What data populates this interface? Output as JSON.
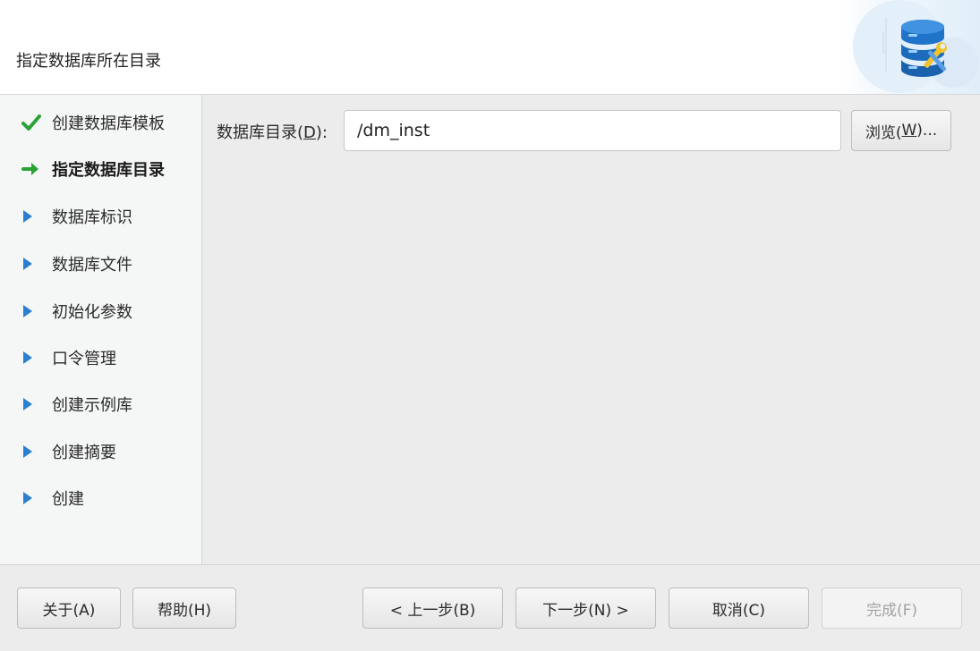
{
  "header": {
    "title": "指定数据库所在目录",
    "logo_icon": "database-tools-icon"
  },
  "sidebar": {
    "steps": [
      {
        "label": "创建数据库模板",
        "status": "done",
        "icon": "check-icon"
      },
      {
        "label": "指定数据库目录",
        "status": "current",
        "icon": "arrow-right-icon"
      },
      {
        "label": "数据库标识",
        "status": "pending",
        "icon": "triangle-right-icon"
      },
      {
        "label": "数据库文件",
        "status": "pending",
        "icon": "triangle-right-icon"
      },
      {
        "label": "初始化参数",
        "status": "pending",
        "icon": "triangle-right-icon"
      },
      {
        "label": "口令管理",
        "status": "pending",
        "icon": "triangle-right-icon"
      },
      {
        "label": "创建示例库",
        "status": "pending",
        "icon": "triangle-right-icon"
      },
      {
        "label": "创建摘要",
        "status": "pending",
        "icon": "triangle-right-icon"
      },
      {
        "label": "创建",
        "status": "pending",
        "icon": "triangle-right-icon"
      }
    ]
  },
  "main": {
    "dir_label_prefix": "数据库目录(",
    "dir_label_mnemonic": "D",
    "dir_label_suffix": "):",
    "dir_value": "/dm_inst",
    "browse_prefix": "浏览(",
    "browse_mnemonic": "W",
    "browse_suffix": ")..."
  },
  "footer": {
    "about": "关于(A)",
    "help": "帮助(H)",
    "back": "< 上一步(B)",
    "next": "下一步(N) >",
    "cancel": "取消(C)",
    "finish": "完成(F)"
  },
  "colors": {
    "check": "#2aa236",
    "arrow": "#2aa236",
    "triangle": "#2b7fd0",
    "db_blue": "#1f73c9"
  }
}
